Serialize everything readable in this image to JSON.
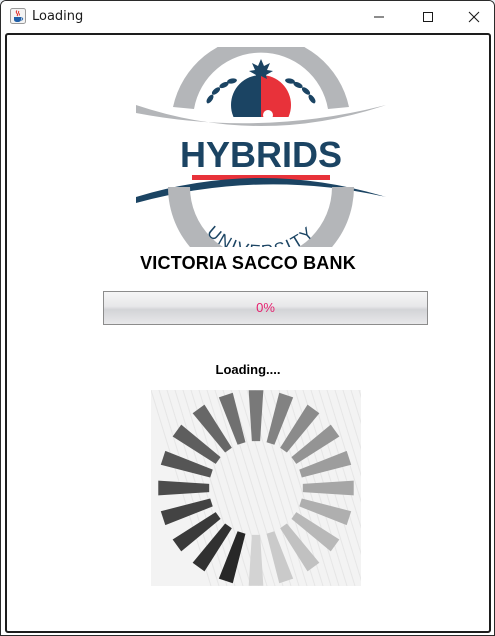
{
  "window": {
    "title": "Loading",
    "icons": {
      "app": "java-cup-icon",
      "minimize": "minimize-icon",
      "maximize": "maximize-icon",
      "close": "close-icon"
    }
  },
  "logo": {
    "wordmark": "HYBRIDS",
    "subtitle": "UNIVERSITY",
    "colors": {
      "navy": "#1b4463",
      "red": "#e8323a",
      "grey": "#b4b6b9",
      "white": "#ffffff"
    }
  },
  "org_name": "VICTORIA SACCO BANK",
  "progress": {
    "value": 0,
    "text": "0%",
    "text_color": "#e5206e"
  },
  "loading_label": "Loading....",
  "spinner": {
    "name": "loading-spinner-icon",
    "segment_count": 20
  }
}
